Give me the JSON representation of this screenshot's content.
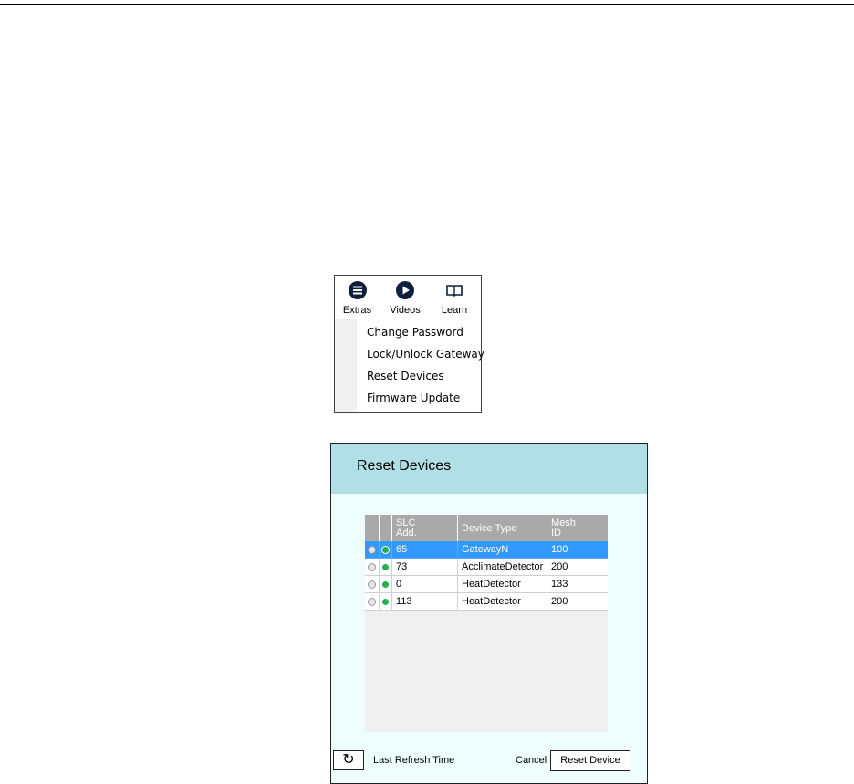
{
  "menu": {
    "tabs": [
      {
        "label": "Extras",
        "icon": "menu-circle-icon"
      },
      {
        "label": "Videos",
        "icon": "play-circle-icon"
      },
      {
        "label": "Learn",
        "icon": "open-book-icon"
      }
    ],
    "items": [
      "Change Password",
      "Lock/Unlock Gateway",
      "Reset Devices",
      "Firmware Update"
    ]
  },
  "dialog": {
    "title": "Reset Devices",
    "columns": {
      "slc_line1": "SLC",
      "slc_line2": "Add.",
      "device_type": "Device Type",
      "mesh_line1": "Mesh",
      "mesh_line2": "ID"
    },
    "rows": [
      {
        "slc": "65",
        "type": "GatewayN",
        "mesh": "100",
        "selected": true
      },
      {
        "slc": "73",
        "type": "AcclimateDetector",
        "mesh": "200",
        "selected": false
      },
      {
        "slc": "0",
        "type": "HeatDetector",
        "mesh": "133",
        "selected": false
      },
      {
        "slc": "113",
        "type": "HeatDetector",
        "mesh": "200",
        "selected": false
      }
    ],
    "refresh_icon": "↻",
    "refresh_label": "Last Refresh Time",
    "cancel_label": "Cancel",
    "reset_label": "Reset Device"
  },
  "colors": {
    "header_bg": "#b0dfe5",
    "dialog_bg": "#eefdfd",
    "selected_row": "#3399ff",
    "status_dot": "#22b14c",
    "icon_navy": "#0d1f3c"
  }
}
